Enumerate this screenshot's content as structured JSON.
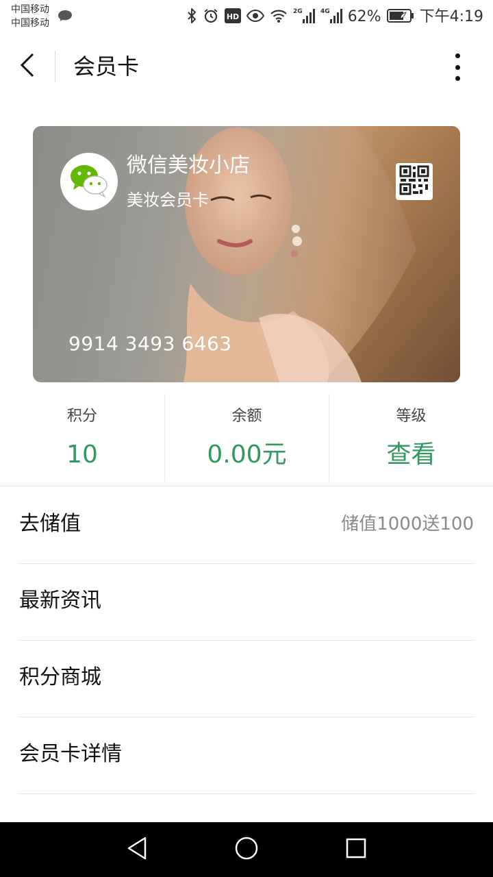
{
  "status_bar": {
    "carrier_line1": "中国移动",
    "carrier_line2": "中国移动",
    "battery": "62%",
    "time": "下午4:19",
    "network_2g": "2G",
    "network_4g": "4G",
    "hd_badge": "HD",
    "icons": [
      "message-icon",
      "bluetooth-icon",
      "alarm-icon",
      "hd-icon",
      "eye-icon",
      "wifi-icon",
      "signal-2g-icon",
      "signal-4g-icon",
      "battery-icon"
    ]
  },
  "nav": {
    "title": "会员卡",
    "back_icon": "chevron-left-icon",
    "more_icon": "more-vertical-icon"
  },
  "card": {
    "shop_name": "微信美妆小店",
    "card_type": "美妆会员卡",
    "card_number": "9914 3493 6463",
    "logo_icon": "wechat-icon",
    "qr_icon": "qr-code-icon"
  },
  "stats": [
    {
      "label": "积分",
      "value": "10"
    },
    {
      "label": "余额",
      "value": "0.00元"
    },
    {
      "label": "等级",
      "value": "查看"
    }
  ],
  "menu": [
    {
      "label": "去储值",
      "extra": "储值1000送100"
    },
    {
      "label": "最新资讯",
      "extra": ""
    },
    {
      "label": "积分商城",
      "extra": ""
    },
    {
      "label": "会员卡详情",
      "extra": ""
    }
  ],
  "system_nav": {
    "back_icon": "triangle-back-icon",
    "home_icon": "circle-home-icon",
    "recents_icon": "square-recents-icon"
  },
  "colors": {
    "accent_green": "#2f9a5e",
    "divider": "#e2e2e2",
    "system_bar": "#000000"
  }
}
